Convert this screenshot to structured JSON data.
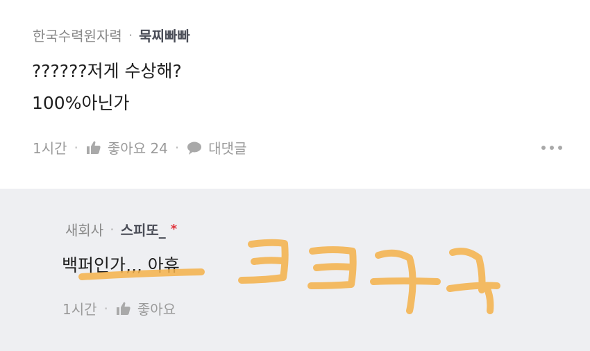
{
  "comment": {
    "company": "한국수력원자력",
    "nickname": "묵찌빠빠",
    "lines": [
      "??????저게 수상해?",
      "100%아닌가"
    ],
    "time": "1시간",
    "like_label": "좋아요 24",
    "reply_label": "대댓글"
  },
  "reply": {
    "company": "새회사",
    "nickname": "스피또_",
    "marker": "*",
    "text": "백퍼인가,,, 아휴",
    "time": "1시간",
    "like_label": "좋아요"
  },
  "colors": {
    "accent_orange": "#f5b14a",
    "reply_background": "#eeeff2",
    "required_marker": "#e0323a"
  },
  "icons": [
    "thumbs-up-icon",
    "speech-bubble-icon",
    "more-dots-icon"
  ]
}
